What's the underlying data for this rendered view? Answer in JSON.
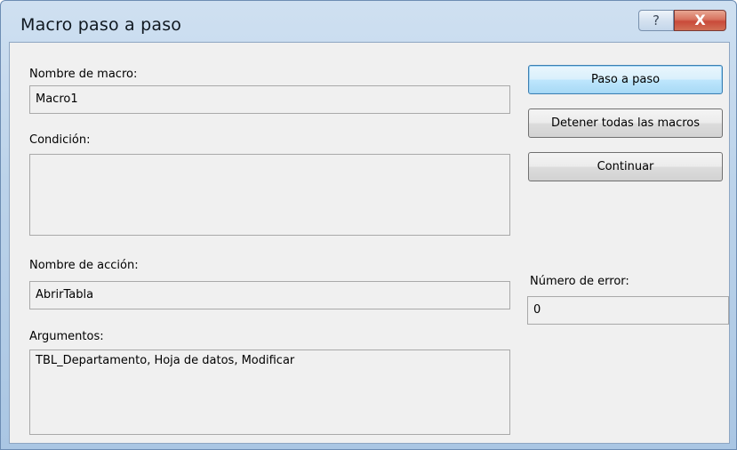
{
  "window": {
    "title": "Macro paso a paso",
    "help_glyph": "?",
    "close_glyph": "X"
  },
  "macro_name": {
    "label": "Nombre de macro:",
    "value": "Macro1"
  },
  "condition": {
    "label": "Condición:",
    "value": ""
  },
  "action_name": {
    "label": "Nombre de acción:",
    "value": "AbrirTabla"
  },
  "arguments": {
    "label": "Argumentos:",
    "value": "TBL_Departamento, Hoja de datos, Modificar"
  },
  "error_number": {
    "label": "Número de error:",
    "value": "0"
  },
  "buttons": {
    "step": "Paso a paso",
    "stop_all": "Detener todas las macros",
    "continue": "Continuar"
  },
  "icons": {
    "help": "help-icon",
    "close": "close-icon"
  },
  "colors": {
    "close_button": "#c94a3a",
    "default_button_border": "#3c7fb1",
    "dialog_background": "#f0f0f0"
  }
}
